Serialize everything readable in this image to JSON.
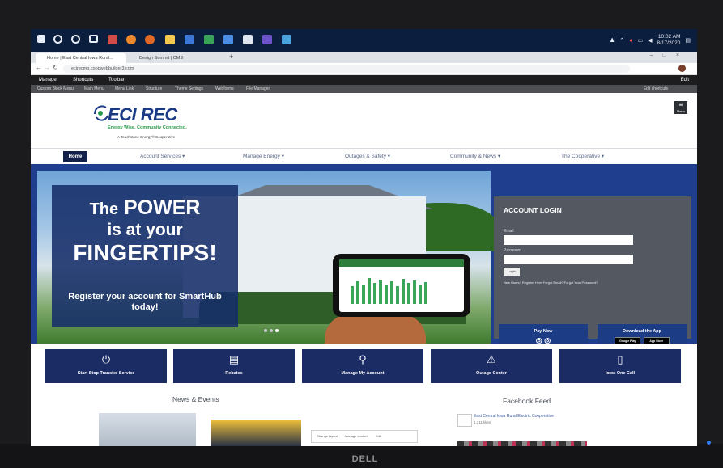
{
  "monitor": {
    "brand": "DELL"
  },
  "taskbar": {
    "time": "10:02 AM",
    "date": "8/17/2020",
    "icons": [
      "windows-start",
      "search",
      "cortana",
      "task-view",
      "app-red",
      "firefox",
      "app-orange",
      "file-explorer",
      "app-blue",
      "app-green",
      "app-blue2",
      "file-doc",
      "app-purple",
      "app-slack"
    ]
  },
  "browser": {
    "tabs": [
      {
        "label": "Home | East Central Iowa Rural..."
      },
      {
        "label": "Design Summit | CMS"
      }
    ],
    "url": "ecirecmp.coopwebbuilder3.com"
  },
  "cms": {
    "bar": {
      "manage": "Manage",
      "shortcuts": "Shortcuts",
      "user": "Toolbar",
      "edit": "Edit"
    },
    "sub": [
      "Custom Block Menu",
      "Main Menu",
      "Menu Link",
      "Structure",
      "Theme Settings",
      "Webforms",
      "File Manager"
    ],
    "sub_right": "Edit shortcuts"
  },
  "site": {
    "logo": "ECI REC",
    "tagline": "Energy Wise. Community Connected.",
    "cooperative_note": "A Touchstone Energy® Cooperative",
    "menu_label": "Menu",
    "nav": {
      "home": "Home",
      "items": [
        "Account Services",
        "Manage Energy",
        "Outages & Safety",
        "Community & News",
        "The Cooperative"
      ]
    },
    "hero": {
      "line1_the": "The",
      "line1_power": "POWER",
      "line2": "is at your",
      "line3": "FINGERTIPS!",
      "register": "Register your account for SmartHub today!"
    },
    "login": {
      "title": "ACCOUNT LOGIN",
      "email_label": "Email",
      "password_label": "Password",
      "button": "Login",
      "links": "New Users? Register Here   Forgot Email? Forgot Your Password?",
      "pay_now": "Pay Now",
      "download": "Download the App",
      "google_play": "Google Play",
      "app_store": "App Store"
    },
    "quick_links": [
      {
        "label": "Start Stop Transfer Service",
        "icon": "power-icon"
      },
      {
        "label": "Rebates",
        "icon": "rebate-icon"
      },
      {
        "label": "Manage My Account",
        "icon": "account-icon"
      },
      {
        "label": "Outage Center",
        "icon": "outage-icon"
      },
      {
        "label": "Iowa One Call",
        "icon": "phone-icon"
      }
    ],
    "news_title": "News & Events",
    "facebook": {
      "title": "Facebook Feed",
      "page_name": "East Central Iowa Rural Electric Cooperative",
      "likes": "1,211 likes"
    },
    "cms_float": {
      "layout": "Change layout",
      "manage": "Manage content",
      "edit": "Edit"
    }
  }
}
